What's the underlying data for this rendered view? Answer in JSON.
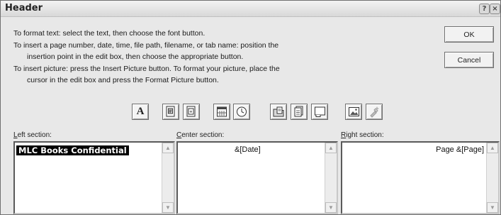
{
  "window": {
    "title": "Header",
    "help_glyph": "?",
    "close_glyph": "×"
  },
  "instructions": [
    "To format text:  select the text, then choose the font button.",
    "To insert a page number, date, time, file path, filename, or tab name:  position the",
    "insertion point in the edit box, then choose the appropriate button.",
    "To insert picture: press the Insert Picture button.  To format your picture, place the",
    "cursor in the edit box and press the Format Picture button."
  ],
  "buttons": {
    "ok": "OK",
    "cancel": "Cancel"
  },
  "toolbar": {
    "icons": [
      "font-icon",
      "page-number-icon",
      "total-pages-icon",
      "date-icon",
      "time-icon",
      "file-path-icon",
      "filename-icon",
      "sheet-name-icon",
      "insert-picture-icon",
      "format-picture-icon"
    ],
    "font_glyph": "A"
  },
  "sections": {
    "left": {
      "label_underlined": "L",
      "label_rest": "eft section:",
      "content": "MLC Books Confidential"
    },
    "center": {
      "label_underlined": "C",
      "label_rest": "enter section:",
      "content": "&[Date]"
    },
    "right": {
      "label_underlined": "R",
      "label_rest": "ight section:",
      "content": "Page &[Page]"
    }
  },
  "colors": {
    "dialog_bg": "#e8e8e8",
    "selection_bg": "#000000"
  }
}
